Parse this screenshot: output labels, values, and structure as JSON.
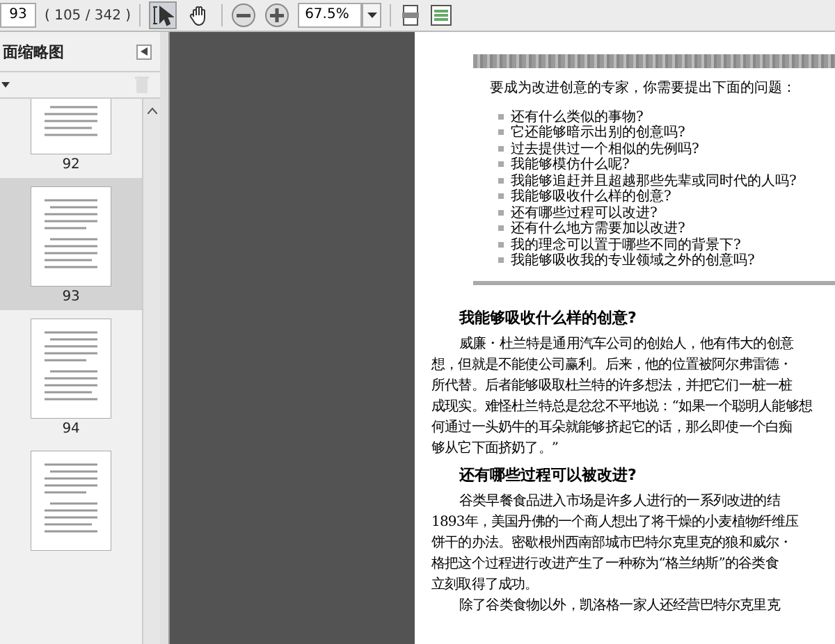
{
  "toolbar": {
    "page_number": "93",
    "page_count": "( 105 / 342 )",
    "tools": [
      {
        "kind": "select",
        "selected": true
      },
      {
        "kind": "hand",
        "selected": false
      }
    ],
    "zoom": "67.5%"
  },
  "sidebar": {
    "title": "面缩略图",
    "thumbnails": [
      {
        "label": "92",
        "selected": false
      },
      {
        "label": "93",
        "selected": true
      },
      {
        "label": "94",
        "selected": false
      },
      {
        "selected": false
      }
    ]
  },
  "document": {
    "intro": "要成为改进创意的专家，你需要提出下面的问题：",
    "questions": [
      "还有什么类似的事物?",
      "它还能够暗示出别的创意吗?",
      "过去提供过一个相似的先例吗?",
      "我能够模仿什么呢?",
      "我能够追赶并且超越那些先辈或同时代的人吗?",
      "我能够吸收什么样的创意?",
      "还有哪些过程可以改进?",
      "还有什么地方需要加以改进?",
      "我的理念可以置于哪些不同的背景下?",
      "我能够吸收我的专业领域之外的创意吗?"
    ],
    "sections": [
      {
        "heading": "我能够吸收什么样的创意?",
        "lines": [
          {
            "text": "威廉・杜兰特是通用汽车公司的创始人，他有伟大的创意",
            "indent": true
          },
          {
            "text": "想，但就是不能使公司赢利。后来，他的位置被阿尔弗雷德・",
            "indent": false
          },
          {
            "text": "所代替。后者能够吸取杜兰特的许多想法，并把它们一桩一桩",
            "indent": false
          },
          {
            "text": "成现实。难怪杜兰特总是忿忿不平地说：“如果一个聪明人能够想",
            "indent": false
          },
          {
            "text": "何通过一头奶牛的耳朵就能够挤起它的话，那么即使一个白痴",
            "indent": false
          },
          {
            "text": "够从它下面挤奶了。”",
            "indent": false
          }
        ]
      },
      {
        "heading": "还有哪些过程可以被改进?",
        "lines": [
          {
            "text": "谷类早餐食品进入市场是许多人进行的一系列改进的结",
            "indent": true
          },
          {
            "text": "1893年，美国丹佛的一个商人想出了将干燥的小麦植物纤维压",
            "indent": false
          },
          {
            "text": "饼干的办法。密歇根州西南部城市巴特尔克里克的狼和威尔・",
            "indent": false
          },
          {
            "text": "格把这个过程进行改进产生了一种称为“格兰纳斯”的谷类食",
            "indent": false
          },
          {
            "text": "立刻取得了成功。",
            "indent": false
          },
          {
            "text": "除了谷类食物以外，凯洛格一家人还经营巴特尔克里克",
            "indent": true
          }
        ]
      }
    ]
  }
}
